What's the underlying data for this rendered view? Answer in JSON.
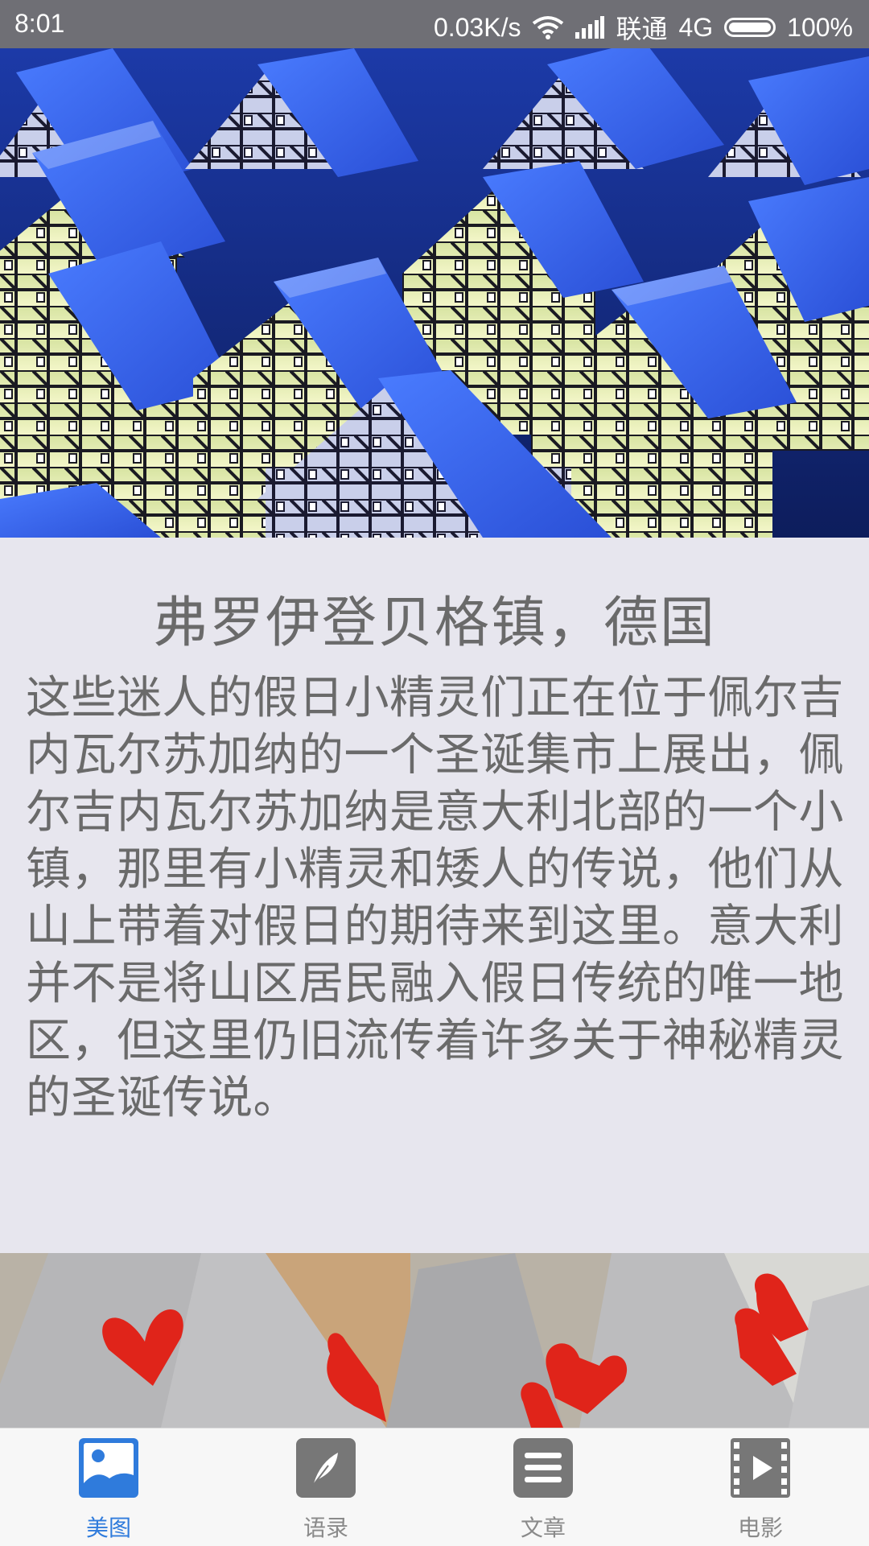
{
  "status_bar": {
    "time": "8:01",
    "speed": "0.03K/s",
    "carrier": "联通",
    "network": "4G",
    "battery": "100%",
    "icons": [
      "wifi-icon",
      "signal-icon",
      "battery-icon"
    ]
  },
  "article": {
    "title": "弗罗伊登贝格镇，德国",
    "body": " 这些迷人的假日小精灵们正在位于佩尔吉内瓦尔苏加纳的一个圣诞集市上展出，佩尔吉内瓦尔苏加纳是意大利北部的一个小镇，那里有小精灵和矮人的传说，他们从山上带着对假日的期待来到这里。意大利并不是将山区居民融入假日传统的唯一地区，但这里仍旧流传着许多关于神秘精灵的圣诞传说。"
  },
  "bottom_nav": {
    "active_color": "#2f7bdc",
    "inactive_color": "#8a8a8a",
    "items": [
      {
        "label": "美图",
        "icon": "picture-icon",
        "active": true
      },
      {
        "label": "语录",
        "icon": "feather-icon",
        "active": false
      },
      {
        "label": "文章",
        "icon": "document-icon",
        "active": false
      },
      {
        "label": "电影",
        "icon": "film-icon",
        "active": false
      }
    ]
  }
}
